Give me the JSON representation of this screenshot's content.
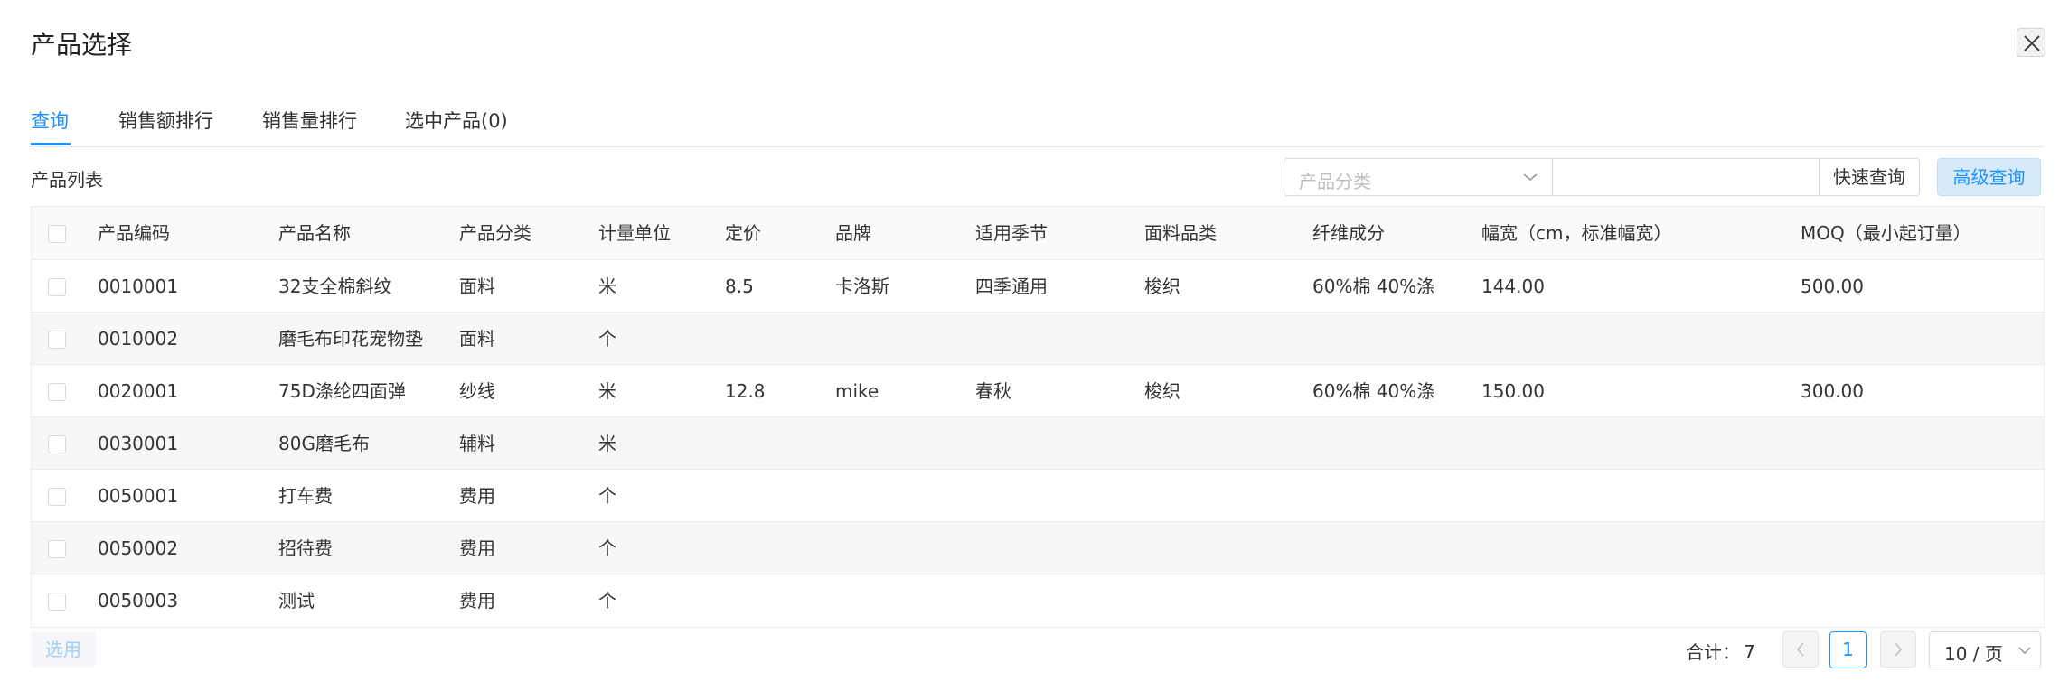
{
  "dialog": {
    "title": "产品选择"
  },
  "tabs": [
    {
      "label": "查询",
      "active": true
    },
    {
      "label": "销售额排行",
      "active": false
    },
    {
      "label": "销售量排行",
      "active": false
    },
    {
      "label": "选中产品(0)",
      "active": false
    }
  ],
  "list_title": "产品列表",
  "search": {
    "category_placeholder": "产品分类",
    "keyword_value": "",
    "quick_label": "快速查询",
    "advanced_label": "高级查询"
  },
  "table": {
    "columns": [
      "产品编码",
      "产品名称",
      "产品分类",
      "计量单位",
      "定价",
      "品牌",
      "适用季节",
      "面料品类",
      "纤维成分",
      "幅宽（cm，标准幅宽）",
      "MOQ（最小起订量）"
    ],
    "rows": [
      [
        "0010001",
        "32支全棉斜纹",
        "面料",
        "米",
        "8.5",
        "卡洛斯",
        "四季通用",
        "梭织",
        "60%棉 40%涤",
        "144.00",
        "500.00"
      ],
      [
        "0010002",
        "磨毛布印花宠物垫",
        "面料",
        "个",
        "",
        "",
        "",
        "",
        "",
        "",
        ""
      ],
      [
        "0020001",
        "75D涤纶四面弹",
        "纱线",
        "米",
        "12.8",
        "mike",
        "春秋",
        "梭织",
        "60%棉 40%涤",
        "150.00",
        "300.00"
      ],
      [
        "0030001",
        "80G磨毛布",
        "辅料",
        "米",
        "",
        "",
        "",
        "",
        "",
        "",
        ""
      ],
      [
        "0050001",
        "打车费",
        "费用",
        "个",
        "",
        "",
        "",
        "",
        "",
        "",
        ""
      ],
      [
        "0050002",
        "招待费",
        "费用",
        "个",
        "",
        "",
        "",
        "",
        "",
        "",
        ""
      ],
      [
        "0050003",
        "测试",
        "费用",
        "个",
        "",
        "",
        "",
        "",
        "",
        "",
        ""
      ]
    ]
  },
  "footer": {
    "apply_label": "选用",
    "total_label": "合计：",
    "total_value": "7",
    "current_page": "1",
    "page_size": "10 / 页"
  },
  "colors": {
    "accent": "#1890ff",
    "border": "#ececec",
    "stripe": "#f7f7f7"
  }
}
